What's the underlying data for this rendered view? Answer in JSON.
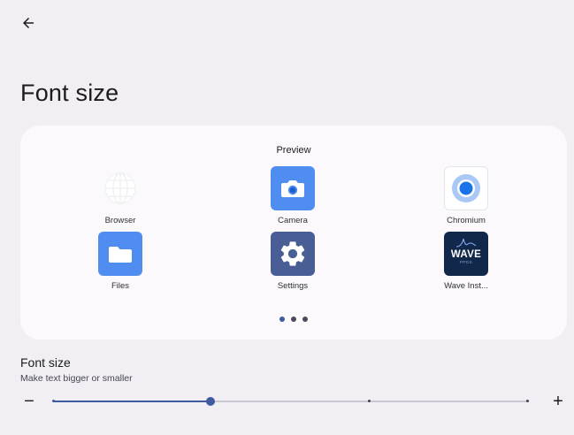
{
  "header": {
    "title": "Font size"
  },
  "preview": {
    "label": "Preview",
    "apps": [
      {
        "label": "Browser",
        "icon": "globe-icon"
      },
      {
        "label": "Camera",
        "icon": "camera-icon"
      },
      {
        "label": "Chromium",
        "icon": "chromium-icon"
      },
      {
        "label": "Files",
        "icon": "folder-icon"
      },
      {
        "label": "Settings",
        "icon": "gear-icon"
      },
      {
        "label": "Wave Inst...",
        "icon": "wave-logo-icon",
        "logo_text": "WAVE",
        "logo_subtext": "PPDS"
      }
    ],
    "page_count": 3,
    "current_page": 0
  },
  "font_size": {
    "title": "Font size",
    "subtitle": "Make text bigger or smaller",
    "steps": 4,
    "current_step": 1,
    "value_fraction": 0.333,
    "decrease_label": "−",
    "increase_label": "+"
  },
  "colors": {
    "background": "#f1eff3",
    "card": "#fbf9fc",
    "accent": "#3f5aa0",
    "camera_icon": "#4f8ef0",
    "settings_icon": "#4a5e96",
    "files_icon": "#4f8ef0",
    "wave_icon": "#12284a"
  }
}
